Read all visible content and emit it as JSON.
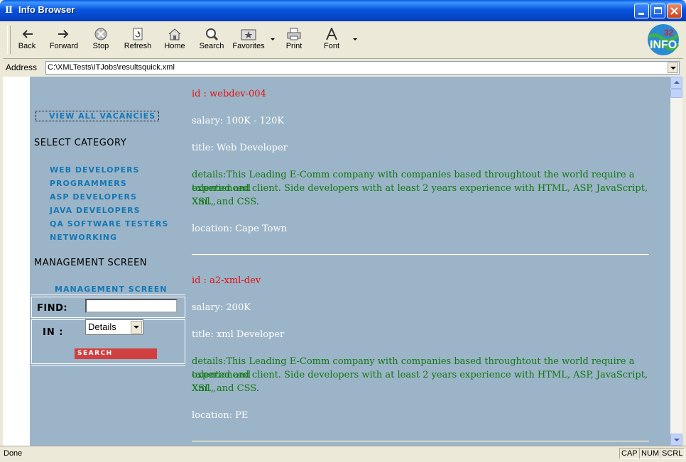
{
  "window": {
    "title": "Info Browser",
    "app_icon": "pillar-icon"
  },
  "toolbar": {
    "buttons": [
      {
        "label": "Back",
        "icon": "back-arrow-icon"
      },
      {
        "label": "Forward",
        "icon": "forward-arrow-icon"
      },
      {
        "label": "Stop",
        "icon": "stop-icon"
      },
      {
        "label": "Refresh",
        "icon": "refresh-icon"
      },
      {
        "label": "Home",
        "icon": "home-icon"
      },
      {
        "label": "Search",
        "icon": "search-icon"
      },
      {
        "label": "Favorites",
        "icon": "favorites-icon"
      },
      {
        "label": "Print",
        "icon": "print-icon"
      },
      {
        "label": "Font",
        "icon": "font-icon"
      }
    ],
    "logo": "32 INFO"
  },
  "address": {
    "label": "Address",
    "value": "C:\\XMLTests\\ITJobs\\resultsquick.xml"
  },
  "sidebar": {
    "view_all": "VIEW ALL VACANCIES",
    "select_category_heading": "SELECT CATEGORY",
    "categories": [
      "WEB DEVELOPERS",
      "PROGRAMMERS",
      "ASP DEVELOPERS",
      "JAVA DEVELOPERS",
      "QA SOFTWARE TESTERS",
      "NETWORKING"
    ],
    "management_heading": "MANAGEMENT SCREEN",
    "management_link": "MANAGEMENT SCREEN",
    "find_label": "FIND:",
    "find_value": "",
    "in_label": "IN :",
    "in_selected": "Details",
    "search_button": "SEARCH"
  },
  "results": [
    {
      "id": "id : webdev-004",
      "salary": "salary: 100K - 120K",
      "title": "title: Web Developer",
      "details_line1": "details:This Leading E-Comm company with companies based throughtout the world require a talented and",
      "details_line2": "experienced client. Side developers with at least 2 years experience with HTML, ASP, JavaScript, Xml ,",
      "details_line3": "XSL, and CSS.",
      "location": "location: Cape Town"
    },
    {
      "id": "id : a2-xml-dev",
      "salary": "salary: 200K",
      "title": "title: xml Developer",
      "details_line1": "details:This Leading E-Comm company with companies based throughtout the world require a talented and",
      "details_line2": "experienced client. Side developers with at least 2 years experience with HTML, ASP, JavaScript, Xml ,",
      "details_line3": "XSL, and CSS.",
      "location": "location: PE"
    }
  ],
  "status": {
    "text": "Done",
    "cap": "CAP",
    "num": "NUM",
    "scrl": "SCRL"
  },
  "colors": {
    "link": "#1478b4",
    "id_text": "#e31010",
    "details_text": "#107810",
    "page_bg": "#9cb4c8",
    "search_button": "#d04040"
  }
}
